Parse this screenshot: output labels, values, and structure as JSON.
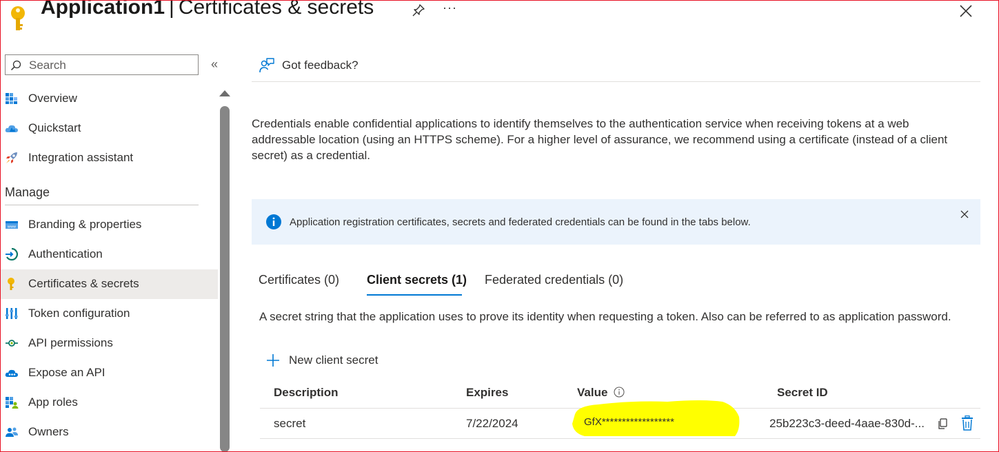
{
  "header": {
    "app_name": "Application1",
    "separator": "|",
    "page_title": "Certificates & secrets",
    "more_label": "···"
  },
  "sidebar": {
    "search": {
      "placeholder": "Search",
      "value": ""
    },
    "collapse_label": "«",
    "top_items": [
      {
        "label": "Overview",
        "icon": "overview-grid-icon"
      },
      {
        "label": "Quickstart",
        "icon": "quickstart-cloud-icon"
      },
      {
        "label": "Integration assistant",
        "icon": "rocket-icon"
      }
    ],
    "section_header": "Manage",
    "manage_items": [
      {
        "label": "Branding & properties",
        "icon": "branding-icon"
      },
      {
        "label": "Authentication",
        "icon": "authentication-icon"
      },
      {
        "label": "Certificates & secrets",
        "icon": "key-icon",
        "active": true
      },
      {
        "label": "Token configuration",
        "icon": "token-config-icon"
      },
      {
        "label": "API permissions",
        "icon": "api-permissions-icon"
      },
      {
        "label": "Expose an API",
        "icon": "expose-api-cloud-icon"
      },
      {
        "label": "App roles",
        "icon": "app-roles-icon"
      },
      {
        "label": "Owners",
        "icon": "owners-icon"
      }
    ]
  },
  "toolbar": {
    "feedback_label": "Got feedback?"
  },
  "main": {
    "description": "Credentials enable confidential applications to identify themselves to the authentication service when receiving tokens at a web addressable location (using an HTTPS scheme). For a higher level of assurance, we recommend using a certificate (instead of a client secret) as a credential.",
    "info_banner": "Application registration certificates, secrets and federated credentials can be found in the tabs below.",
    "tabs": [
      {
        "label": "Certificates (0)"
      },
      {
        "label": "Client secrets (1)",
        "active": true
      },
      {
        "label": "Federated credentials (0)"
      }
    ],
    "secrets_description": "A secret string that the application uses to prove its identity when requesting a token. Also can be referred to as application password.",
    "new_secret_label": "New client secret",
    "table": {
      "columns": [
        "Description",
        "Expires",
        "Value",
        "Secret ID"
      ],
      "rows": [
        {
          "description": "secret",
          "expires": "7/22/2024",
          "value": "GfX******************",
          "secret_id": "25b223c3-deed-4aae-830d-..."
        }
      ]
    }
  },
  "colors": {
    "accent": "#0078d4",
    "highlight": "#ffff00",
    "active_nav_bg": "#edebe9",
    "info_bg": "#ebf3fc",
    "key_gold": "#f2b705",
    "frame_red": "#e81123"
  }
}
